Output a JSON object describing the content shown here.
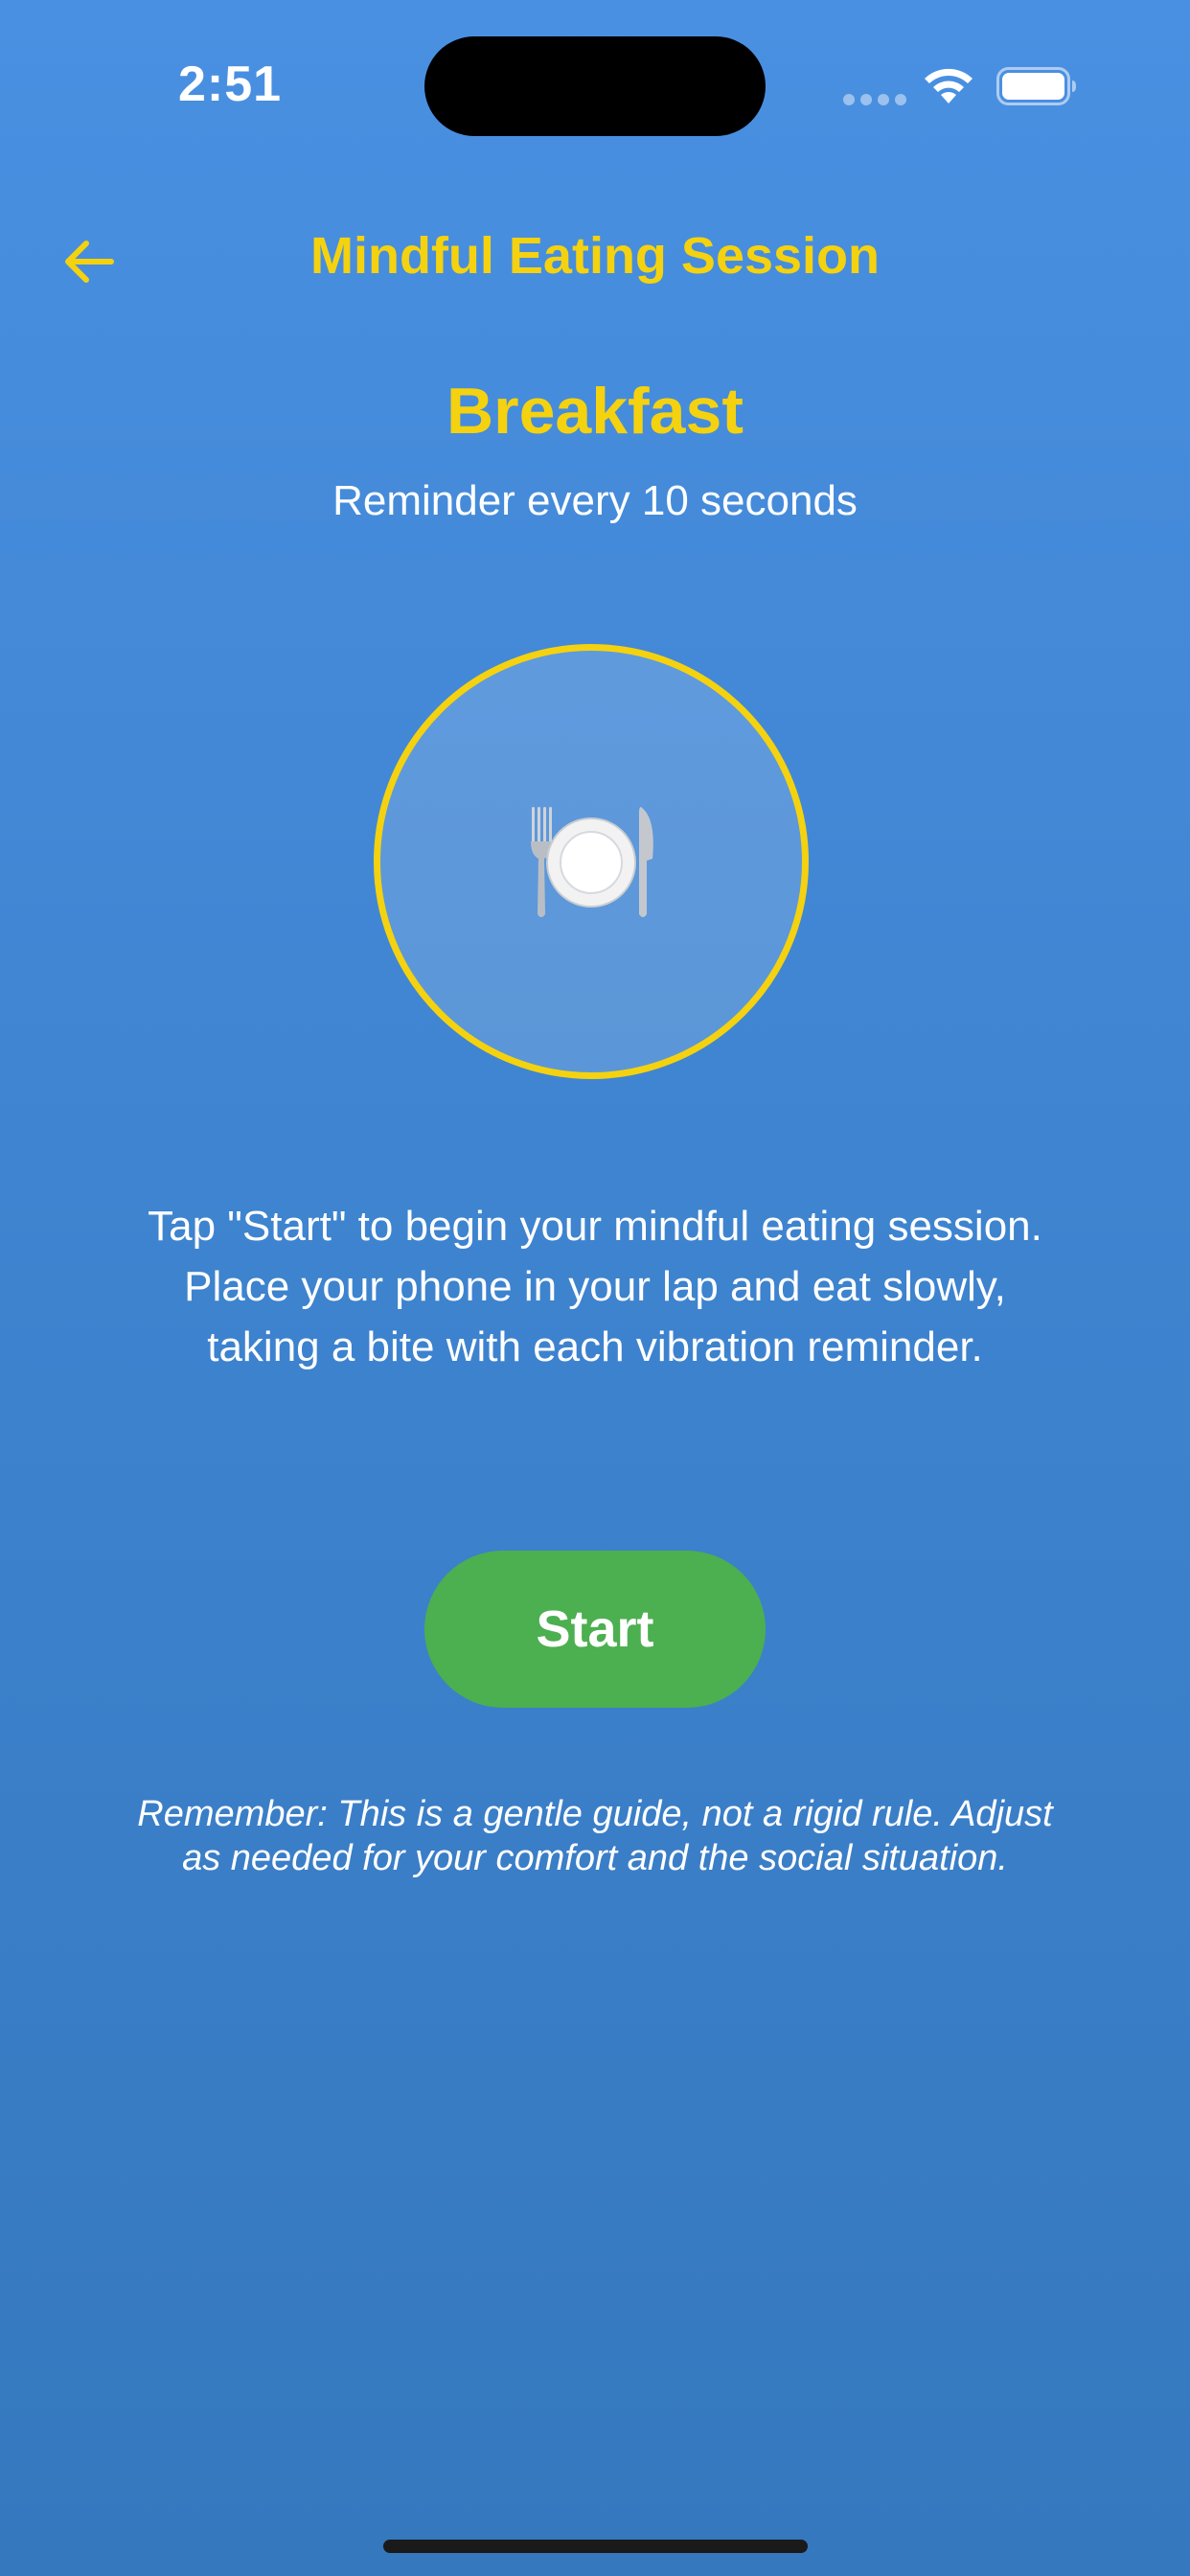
{
  "status_bar": {
    "time": "2:51",
    "icons": [
      "signal-icon",
      "wifi-icon",
      "battery-icon"
    ]
  },
  "header": {
    "back_icon": "arrow-left-icon",
    "title": "Mindful Eating Session"
  },
  "session": {
    "meal": "Breakfast",
    "reminder": "Reminder every 10 seconds",
    "meal_icon": "plate-with-cutlery-icon",
    "instructions": "Tap \"Start\" to begin your mindful eating session. Place your phone in your lap and eat slowly, taking a bite with each vibration reminder.",
    "start_label": "Start",
    "note": "Remember: This is a gentle guide, not a rigid rule. Adjust as needed for your comfort and the social situation."
  },
  "colors": {
    "background_top": "#4A90E2",
    "background_bottom": "#3578BE",
    "accent": "#F5D20F",
    "start_button": "#4CAF50",
    "text": "#FFFFFF"
  }
}
